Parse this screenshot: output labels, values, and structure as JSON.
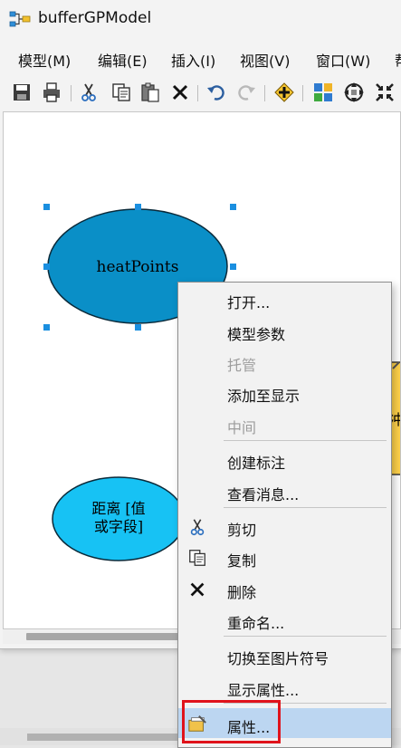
{
  "window": {
    "title": "bufferGPModel"
  },
  "menubar": {
    "items": [
      "模型(M)",
      "编辑(E)",
      "插入(I)",
      "视图(V)",
      "窗口(W)",
      "帮"
    ]
  },
  "toolbar": {
    "icons": [
      "save-icon",
      "print-icon",
      "cut-icon",
      "copy-icon",
      "paste-icon",
      "delete-icon",
      "undo-icon",
      "redo-icon",
      "add-data-icon",
      "auto-layout-icon",
      "full-extent-icon",
      "fixed-zoom-out-icon"
    ]
  },
  "canvas": {
    "nodes": [
      {
        "label": "heatPoints",
        "fill": "#0a8fc7"
      },
      {
        "label_line1": "距离 [值",
        "label_line2": "或字段]",
        "fill": "#17c2f4"
      },
      {
        "label": "冲",
        "fill": "#ffd24a"
      }
    ]
  },
  "context_menu": {
    "items": [
      {
        "label": "打开...",
        "enabled": true
      },
      {
        "label": "模型参数",
        "enabled": true
      },
      {
        "label": "托管",
        "enabled": false
      },
      {
        "label": "添加至显示",
        "enabled": true
      },
      {
        "label": "中间",
        "enabled": false
      },
      {
        "label": "创建标注",
        "enabled": true
      },
      {
        "label": "查看消息...",
        "enabled": true
      },
      {
        "label": "剪切",
        "enabled": true,
        "icon": "cut-icon"
      },
      {
        "label": "复制",
        "enabled": true,
        "icon": "copy-icon"
      },
      {
        "label": "删除",
        "enabled": true,
        "icon": "delete-icon"
      },
      {
        "label": "重命名...",
        "enabled": true
      },
      {
        "label": "切换至图片符号",
        "enabled": true
      },
      {
        "label": "显示属性...",
        "enabled": true
      },
      {
        "label": "属性...",
        "enabled": true,
        "icon": "properties-icon",
        "highlighted": true
      }
    ]
  },
  "colors": {
    "highlight_border": "#e0131b",
    "hover_fill": "#bcd6f1",
    "node_selected": "#0a8fc7",
    "node_variable": "#17c2f4",
    "node_tool": "#ffd24a"
  }
}
